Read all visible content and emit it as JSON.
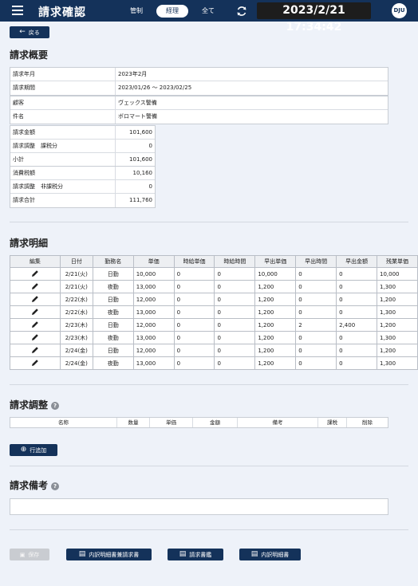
{
  "header": {
    "title": "請求確認",
    "tabs": [
      "管制",
      "経理",
      "全て"
    ],
    "active_tab": "経理",
    "datetime": "2023/2/21 17:34:42",
    "avatar_initials": "DJU"
  },
  "back_label": "戻る",
  "overview": {
    "title": "請求概要",
    "period": [
      {
        "key": "請求年月",
        "value": "2023年2月"
      },
      {
        "key": "請求期間",
        "value": "2023/01/26 〜 2023/02/25"
      }
    ],
    "customer": [
      {
        "key": "顧客",
        "value": "ヴェックス警備"
      },
      {
        "key": "件名",
        "value": "ボロマート警備"
      }
    ],
    "amounts": [
      {
        "key": "請求金額",
        "value": "101,600"
      },
      {
        "key": "請求調整　課税分",
        "value": "0"
      },
      {
        "key": "小計",
        "value": "101,600"
      }
    ],
    "totals": [
      {
        "key": "消費税額",
        "value": "10,160"
      },
      {
        "key": "請求調整　非課税分",
        "value": "0"
      },
      {
        "key": "請求合計",
        "value": "111,760"
      }
    ]
  },
  "details": {
    "title": "請求明細",
    "columns": [
      "編集",
      "日付",
      "勤務名",
      "単価",
      "時給単価",
      "時給時間",
      "早出単価",
      "早出時間",
      "早出金額",
      "残業単価"
    ],
    "rows": [
      [
        "2/21(火)",
        "日勤",
        "10,000",
        "0",
        "0",
        "10,000",
        "0",
        "0",
        "10,000"
      ],
      [
        "2/21(火)",
        "夜勤",
        "13,000",
        "0",
        "0",
        "1,200",
        "0",
        "0",
        "1,300"
      ],
      [
        "2/22(水)",
        "日勤",
        "12,000",
        "0",
        "0",
        "1,200",
        "0",
        "0",
        "1,200"
      ],
      [
        "2/22(水)",
        "夜勤",
        "13,000",
        "0",
        "0",
        "1,200",
        "0",
        "0",
        "1,300"
      ],
      [
        "2/23(木)",
        "日勤",
        "12,000",
        "0",
        "0",
        "1,200",
        "2",
        "2,400",
        "1,200"
      ],
      [
        "2/23(木)",
        "夜勤",
        "13,000",
        "0",
        "0",
        "1,200",
        "0",
        "0",
        "1,300"
      ],
      [
        "2/24(金)",
        "日勤",
        "12,000",
        "0",
        "0",
        "1,200",
        "0",
        "0",
        "1,200"
      ],
      [
        "2/24(金)",
        "夜勤",
        "13,000",
        "0",
        "0",
        "1,200",
        "0",
        "0",
        "1,300"
      ]
    ]
  },
  "adjustment": {
    "title": "請求調整",
    "columns": [
      "名称",
      "数量",
      "単価",
      "金額",
      "備考",
      "課税",
      "削除"
    ],
    "add_row_label": "行追加"
  },
  "notes": {
    "title": "請求備考",
    "value": ""
  },
  "footer": {
    "save_label": "保存",
    "combined_label": "内訳明細書兼請求書",
    "invoice_label": "請求書鑑",
    "breakdown_label": "内訳明細書"
  },
  "colors": {
    "primary": "#14325a",
    "background": "#eef2f9"
  }
}
